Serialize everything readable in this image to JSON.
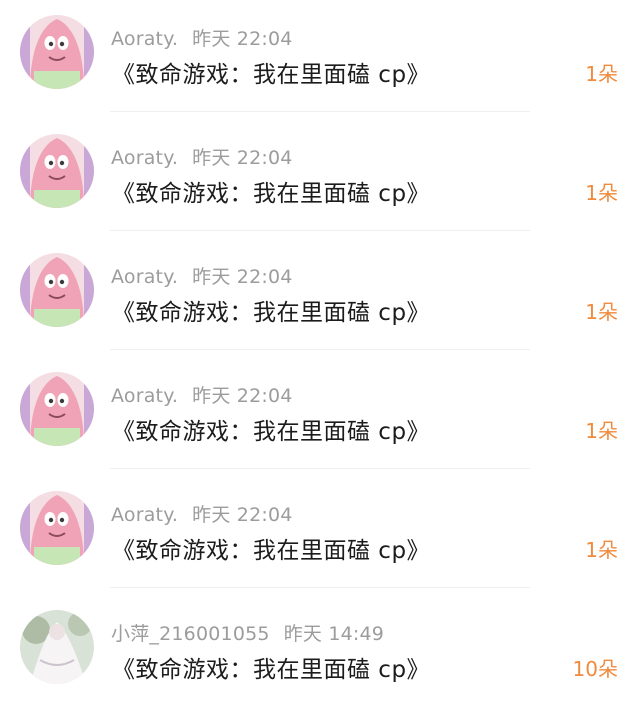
{
  "comments": [
    {
      "user": "Aoraty.",
      "time": "昨天 22:04",
      "title": "《致命游戏：我在里面磕 cp》",
      "gift": "1朵",
      "avatar": "patrick-avatar-icon"
    },
    {
      "user": "Aoraty.",
      "time": "昨天 22:04",
      "title": "《致命游戏：我在里面磕 cp》",
      "gift": "1朵",
      "avatar": "patrick-avatar-icon"
    },
    {
      "user": "Aoraty.",
      "time": "昨天 22:04",
      "title": "《致命游戏：我在里面磕 cp》",
      "gift": "1朵",
      "avatar": "patrick-avatar-icon"
    },
    {
      "user": "Aoraty.",
      "time": "昨天 22:04",
      "title": "《致命游戏：我在里面磕 cp》",
      "gift": "1朵",
      "avatar": "patrick-avatar-icon"
    },
    {
      "user": "Aoraty.",
      "time": "昨天 22:04",
      "title": "《致命游戏：我在里面磕 cp》",
      "gift": "1朵",
      "avatar": "patrick-avatar-icon"
    },
    {
      "user": "小萍_216001055",
      "time": "昨天 14:49",
      "title": "《致命游戏：我在里面磕 cp》",
      "gift": "10朵",
      "avatar": "white-dress-avatar-icon"
    }
  ],
  "colors": {
    "username": "#9c9c9c",
    "title": "#1c1c1c",
    "gift": "#f08a3c",
    "divider": "#efefef"
  }
}
